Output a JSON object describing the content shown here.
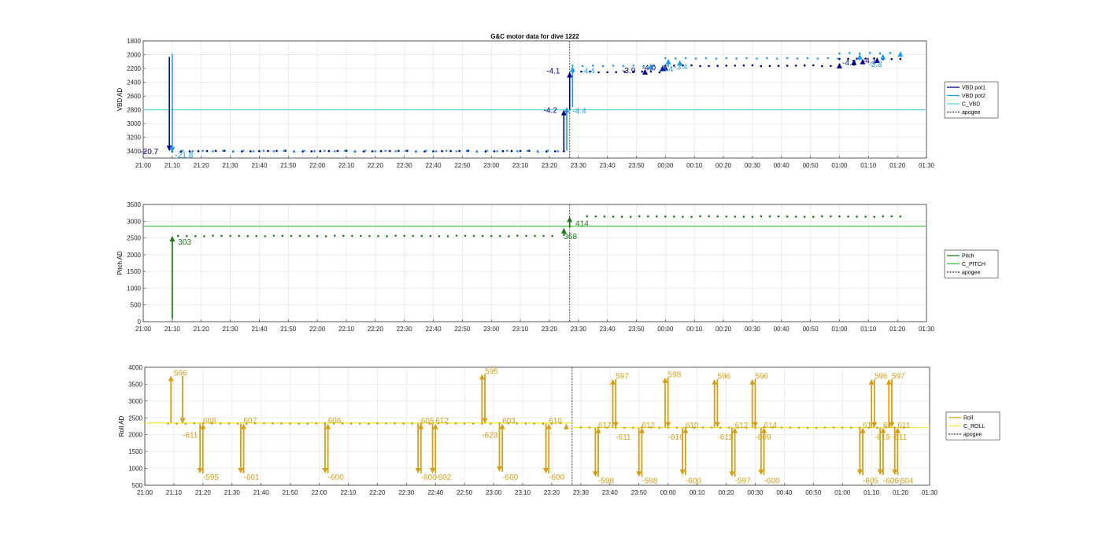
{
  "chart_data": [
    {
      "type": "scatter",
      "title": "G&C motor data for dive 1222",
      "ylabel": "VBD AD",
      "xlim": [
        "21:00",
        "01:30"
      ],
      "ylim": [
        3500,
        1800
      ],
      "y_reversed": true,
      "yticks": [
        1800,
        2000,
        2200,
        2400,
        2600,
        2800,
        3000,
        3200,
        3400
      ],
      "xticks": [
        "21:00",
        "21:10",
        "21:20",
        "21:30",
        "21:40",
        "21:50",
        "22:00",
        "22:10",
        "22:20",
        "22:30",
        "22:40",
        "22:50",
        "23:00",
        "23:10",
        "23:20",
        "23:30",
        "23:40",
        "23:50",
        "00:00",
        "00:10",
        "00:20",
        "00:30",
        "00:40",
        "00:50",
        "01:00",
        "01:10",
        "01:20",
        "01:30"
      ],
      "grid": true,
      "legend_position": "right",
      "legend": [
        "VBD pot1",
        "VBD pot2",
        "C_VBD",
        "apogee"
      ],
      "colors": {
        "pot1": "#00008b",
        "pot2": "#1e9be6",
        "c_vbd": "#5fd6e6",
        "apogee": "#333333"
      },
      "c_vbd": 2800,
      "apogee_time": "23:27",
      "pot1_level_segments": [
        {
          "t": [
            "21:10",
            "23:26"
          ],
          "value": 3400
        },
        {
          "t": [
            "23:28",
            "00:00"
          ],
          "value": 2250
        },
        {
          "t": [
            "00:00",
            "01:00"
          ],
          "value": 2160
        },
        {
          "t": [
            "01:00",
            "01:22"
          ],
          "value": 2060
        }
      ],
      "pot2_level_segments": [
        {
          "t": [
            "21:10",
            "23:26"
          ],
          "value": 3395
        },
        {
          "t": [
            "23:28",
            "00:00"
          ],
          "value": 2160
        },
        {
          "t": [
            "00:00",
            "01:00"
          ],
          "value": 2050
        },
        {
          "t": [
            "01:00",
            "01:23"
          ],
          "value": 1980
        }
      ],
      "moves": [
        {
          "series": "pot1",
          "t": "21:09",
          "from": 2030,
          "to": 3400
        },
        {
          "series": "pot2",
          "t": "21:10",
          "from": 1990,
          "to": 3420
        },
        {
          "series": "pot1",
          "t": "23:25",
          "from": 3400,
          "to": 2800
        },
        {
          "series": "pot2",
          "t": "23:26",
          "from": 3390,
          "to": 2760
        },
        {
          "series": "pot1",
          "t": "23:27",
          "from": 2800,
          "to": 2250
        },
        {
          "series": "pot2",
          "t": "23:28",
          "from": 2760,
          "to": 2170
        },
        {
          "series": "pot1",
          "t": "23:53",
          "from": 2250,
          "to": 2210
        },
        {
          "series": "pot2",
          "t": "23:55",
          "from": 2240,
          "to": 2130
        },
        {
          "series": "pot1",
          "t": "23:59",
          "from": 2240,
          "to": 2160
        },
        {
          "series": "pot2",
          "t": "00:01",
          "from": 2180,
          "to": 2060
        },
        {
          "series": "pot1",
          "t": "00:00",
          "from": 2230,
          "to": 2150
        },
        {
          "series": "pot2",
          "t": "00:05",
          "from": 2150,
          "to": 2080
        },
        {
          "series": "pot1",
          "t": "01:00",
          "from": 2170,
          "to": 2120
        },
        {
          "series": "pot1",
          "t": "01:05",
          "from": 2160,
          "to": 2070
        },
        {
          "series": "pot2",
          "t": "01:07",
          "from": 2080,
          "to": 1990
        },
        {
          "series": "pot1",
          "t": "01:08",
          "from": 2130,
          "to": 2060
        },
        {
          "series": "pot1",
          "t": "01:13",
          "from": 2120,
          "to": 2040
        },
        {
          "series": "pot2",
          "t": "01:15",
          "from": 2070,
          "to": 1990
        },
        {
          "series": "pot2",
          "t": "01:21",
          "from": 2000,
          "to": 1950
        }
      ],
      "annotations": [
        {
          "text": "-20.7",
          "t": "20:59",
          "value": 3400,
          "color": "pot1"
        },
        {
          "text": "-21.8",
          "t": "21:11",
          "value": 3450,
          "color": "pot2"
        },
        {
          "text": "-4.2",
          "t": "23:18",
          "value": 2800,
          "color": "pot1"
        },
        {
          "text": "-4.1",
          "t": "23:19",
          "value": 2230,
          "color": "pot1"
        },
        {
          "text": "-4.4",
          "t": "23:28",
          "value": 2810,
          "color": "pot2"
        },
        {
          "text": "-4.4",
          "t": "23:31",
          "value": 2230,
          "color": "pot2"
        },
        {
          "text": "-3.9",
          "t": "23:45",
          "value": 2220,
          "color": "pot1"
        },
        {
          "text": "-4.0",
          "t": "23:52",
          "value": 2180,
          "color": "pot1"
        },
        {
          "text": "-3.4",
          "t": "23:58",
          "value": 2200,
          "color": "pot2"
        },
        {
          "text": "-3.4",
          "t": "00:03",
          "value": 2170,
          "color": "pot2"
        },
        {
          "text": "-4.2",
          "t": "01:01",
          "value": 2110,
          "color": "pot1"
        },
        {
          "text": "-4.1",
          "t": "01:08",
          "value": 2080,
          "color": "pot1"
        },
        {
          "text": "-3.8",
          "t": "01:10",
          "value": 2130,
          "color": "pot2"
        }
      ]
    },
    {
      "type": "scatter",
      "title": "",
      "ylabel": "Pitch AD",
      "xlim": [
        "21:00",
        "01:30"
      ],
      "ylim": [
        0,
        3500
      ],
      "yticks": [
        0,
        500,
        1000,
        1500,
        2000,
        2500,
        3000,
        3500
      ],
      "xticks": [
        "21:00",
        "21:10",
        "21:20",
        "21:30",
        "21:40",
        "21:50",
        "22:00",
        "22:10",
        "22:20",
        "22:30",
        "22:40",
        "22:50",
        "23:00",
        "23:10",
        "23:20",
        "23:30",
        "23:40",
        "23:50",
        "00:00",
        "00:10",
        "00:20",
        "00:30",
        "00:40",
        "00:50",
        "01:00",
        "01:10",
        "01:20",
        "01:30"
      ],
      "grid": true,
      "legend_position": "right",
      "legend": [
        "Pitch",
        "C_PITCH",
        "apogee"
      ],
      "colors": {
        "pitch": "#1e7a1e",
        "c_pitch": "#3cc43c",
        "apogee": "#333333"
      },
      "c_pitch": 2850,
      "apogee_time": "23:27",
      "pitch_level_segments": [
        {
          "t": [
            "21:12",
            "23:23"
          ],
          "value": 2560
        },
        {
          "t": [
            "23:33",
            "01:22"
          ],
          "value": 3140
        }
      ],
      "moves": [
        {
          "t": "21:10",
          "from": 80,
          "to": 2560
        },
        {
          "t": "23:25",
          "from": 2560,
          "to": 2800
        },
        {
          "t": "23:27",
          "from": 2800,
          "to": 3140
        }
      ],
      "annotations": [
        {
          "text": "303",
          "t": "21:12",
          "value": 2400
        },
        {
          "text": "368",
          "t": "23:25",
          "value": 2560
        },
        {
          "text": "414",
          "t": "23:29",
          "value": 2950
        }
      ]
    },
    {
      "type": "scatter",
      "title": "",
      "ylabel": "Roll AD",
      "xlim": [
        "21:00",
        "01:30"
      ],
      "ylim": [
        500,
        4000
      ],
      "yticks": [
        500,
        1000,
        1500,
        2000,
        2500,
        3000,
        3500,
        4000
      ],
      "xticks": [
        "21:00",
        "21:10",
        "21:20",
        "21:30",
        "21:40",
        "21:50",
        "22:00",
        "22:10",
        "22:20",
        "22:30",
        "22:40",
        "22:50",
        "23:00",
        "23:10",
        "23:20",
        "23:30",
        "23:40",
        "23:50",
        "00:00",
        "00:10",
        "00:20",
        "00:30",
        "00:40",
        "00:50",
        "01:00",
        "01:10",
        "01:20",
        "01:30"
      ],
      "grid": true,
      "legend_position": "right",
      "legend": [
        "Roll",
        "C_ROLL",
        "apogee"
      ],
      "colors": {
        "roll": "#d4a017",
        "c_roll": "#f5e542",
        "apogee": "#333333"
      },
      "c_roll_dive": 2350,
      "c_roll_climb": 2210,
      "apogee_time": "23:27",
      "roll_level_dive": 2330,
      "roll_level_climb": 2210,
      "moves": [
        {
          "t": "21:09",
          "from": 2350,
          "to": 3750
        },
        {
          "t": "21:13",
          "from": 3750,
          "to": 2330
        },
        {
          "t": "21:19",
          "from": 2330,
          "to": 850
        },
        {
          "t": "21:20",
          "from": 850,
          "to": 2330
        },
        {
          "t": "21:33",
          "from": 2330,
          "to": 850
        },
        {
          "t": "21:34",
          "from": 850,
          "to": 2330
        },
        {
          "t": "22:02",
          "from": 2330,
          "to": 850
        },
        {
          "t": "22:03",
          "from": 850,
          "to": 2330
        },
        {
          "t": "22:34",
          "from": 2330,
          "to": 850
        },
        {
          "t": "22:35",
          "from": 850,
          "to": 2330
        },
        {
          "t": "22:39",
          "from": 2330,
          "to": 850
        },
        {
          "t": "22:40",
          "from": 850,
          "to": 2330
        },
        {
          "t": "22:56",
          "from": 2330,
          "to": 3800
        },
        {
          "t": "22:57",
          "from": 3800,
          "to": 2330
        },
        {
          "t": "23:02",
          "from": 2330,
          "to": 900
        },
        {
          "t": "23:03",
          "from": 900,
          "to": 2330
        },
        {
          "t": "23:18",
          "from": 2330,
          "to": 850
        },
        {
          "t": "23:19",
          "from": 850,
          "to": 2330
        },
        {
          "t": "23:25",
          "from": 2150,
          "to": 2330
        },
        {
          "t": "23:35",
          "from": 2210,
          "to": 750
        },
        {
          "t": "23:36",
          "from": 750,
          "to": 2210
        },
        {
          "t": "23:41",
          "from": 2210,
          "to": 3650
        },
        {
          "t": "23:42",
          "from": 3650,
          "to": 2210
        },
        {
          "t": "23:50",
          "from": 2210,
          "to": 750
        },
        {
          "t": "23:51",
          "from": 750,
          "to": 2210
        },
        {
          "t": "23:59",
          "from": 2210,
          "to": 3700
        },
        {
          "t": "00:00",
          "from": 3700,
          "to": 2210
        },
        {
          "t": "00:05",
          "from": 2210,
          "to": 800
        },
        {
          "t": "00:06",
          "from": 800,
          "to": 2210
        },
        {
          "t": "00:16",
          "from": 2210,
          "to": 3650
        },
        {
          "t": "00:17",
          "from": 3650,
          "to": 2210
        },
        {
          "t": "00:22",
          "from": 2210,
          "to": 750
        },
        {
          "t": "00:23",
          "from": 750,
          "to": 2210
        },
        {
          "t": "00:29",
          "from": 2210,
          "to": 3650
        },
        {
          "t": "00:30",
          "from": 3650,
          "to": 2210
        },
        {
          "t": "00:32",
          "from": 2210,
          "to": 800
        },
        {
          "t": "00:33",
          "from": 800,
          "to": 2210
        },
        {
          "t": "01:06",
          "from": 2210,
          "to": 800
        },
        {
          "t": "01:07",
          "from": 800,
          "to": 2210
        },
        {
          "t": "01:10",
          "from": 2210,
          "to": 3650
        },
        {
          "t": "01:11",
          "from": 3650,
          "to": 2210
        },
        {
          "t": "01:13",
          "from": 2210,
          "to": 800
        },
        {
          "t": "01:14",
          "from": 800,
          "to": 2210
        },
        {
          "t": "01:16",
          "from": 2210,
          "to": 3650
        },
        {
          "t": "01:17",
          "from": 3650,
          "to": 2210
        },
        {
          "t": "01:18",
          "from": 2210,
          "to": 800
        },
        {
          "t": "01:19",
          "from": 800,
          "to": 2210
        }
      ],
      "annotations": [
        {
          "text": "596",
          "t": "21:10",
          "value": 3850
        },
        {
          "text": "-611",
          "t": "21:13",
          "value": 2000
        },
        {
          "text": "608",
          "t": "21:20",
          "value": 2420
        },
        {
          "text": "-595",
          "t": "21:20",
          "value": 760
        },
        {
          "text": "607",
          "t": "21:34",
          "value": 2440
        },
        {
          "text": "-601",
          "t": "21:34",
          "value": 760
        },
        {
          "text": "606",
          "t": "22:03",
          "value": 2440
        },
        {
          "text": "-600",
          "t": "22:03",
          "value": 760
        },
        {
          "text": "605",
          "t": "22:35",
          "value": 2420
        },
        {
          "text": "-600",
          "t": "22:35",
          "value": 760
        },
        {
          "text": "612",
          "t": "22:40",
          "value": 2440
        },
        {
          "text": "-602",
          "t": "22:40",
          "value": 760
        },
        {
          "text": "595",
          "t": "22:57",
          "value": 3900
        },
        {
          "text": "-623",
          "t": "22:56",
          "value": 2000
        },
        {
          "text": "603",
          "t": "23:03",
          "value": 2420
        },
        {
          "text": "-600",
          "t": "23:03",
          "value": 760
        },
        {
          "text": "610",
          "t": "23:19",
          "value": 2420
        },
        {
          "text": "-600",
          "t": "23:19",
          "value": 760
        },
        {
          "text": "617",
          "t": "23:36",
          "value": 2300
        },
        {
          "text": "-598",
          "t": "23:36",
          "value": 650
        },
        {
          "text": "597",
          "t": "23:42",
          "value": 3750
        },
        {
          "text": "-611",
          "t": "23:42",
          "value": 1950
        },
        {
          "text": "612",
          "t": "23:51",
          "value": 2300
        },
        {
          "text": "-598",
          "t": "23:51",
          "value": 650
        },
        {
          "text": "598",
          "t": "00:00",
          "value": 3800
        },
        {
          "text": "-616",
          "t": "00:00",
          "value": 1950
        },
        {
          "text": "610",
          "t": "00:06",
          "value": 2300
        },
        {
          "text": "-600",
          "t": "00:06",
          "value": 650
        },
        {
          "text": "596",
          "t": "00:17",
          "value": 3750
        },
        {
          "text": "-611",
          "t": "00:17",
          "value": 1950
        },
        {
          "text": "612",
          "t": "00:23",
          "value": 2300
        },
        {
          "text": "-597",
          "t": "00:23",
          "value": 650
        },
        {
          "text": "596",
          "t": "00:30",
          "value": 3750
        },
        {
          "text": "-609",
          "t": "00:30",
          "value": 1950
        },
        {
          "text": "614",
          "t": "00:33",
          "value": 2300
        },
        {
          "text": "-600",
          "t": "00:33",
          "value": 650
        },
        {
          "text": "617",
          "t": "01:07",
          "value": 2300
        },
        {
          "text": "-605",
          "t": "01:07",
          "value": 650
        },
        {
          "text": "596",
          "t": "01:11",
          "value": 3750
        },
        {
          "text": "-619",
          "t": "01:11",
          "value": 1950
        },
        {
          "text": "61",
          "t": "01:14",
          "value": 2300
        },
        {
          "text": "-606",
          "t": "01:14",
          "value": 650
        },
        {
          "text": "597",
          "t": "01:17",
          "value": 3750
        },
        {
          "text": "-611",
          "t": "01:17",
          "value": 1950
        },
        {
          "text": "611",
          "t": "01:19",
          "value": 2300
        },
        {
          "text": "-604",
          "t": "01:19",
          "value": 650
        }
      ]
    }
  ]
}
